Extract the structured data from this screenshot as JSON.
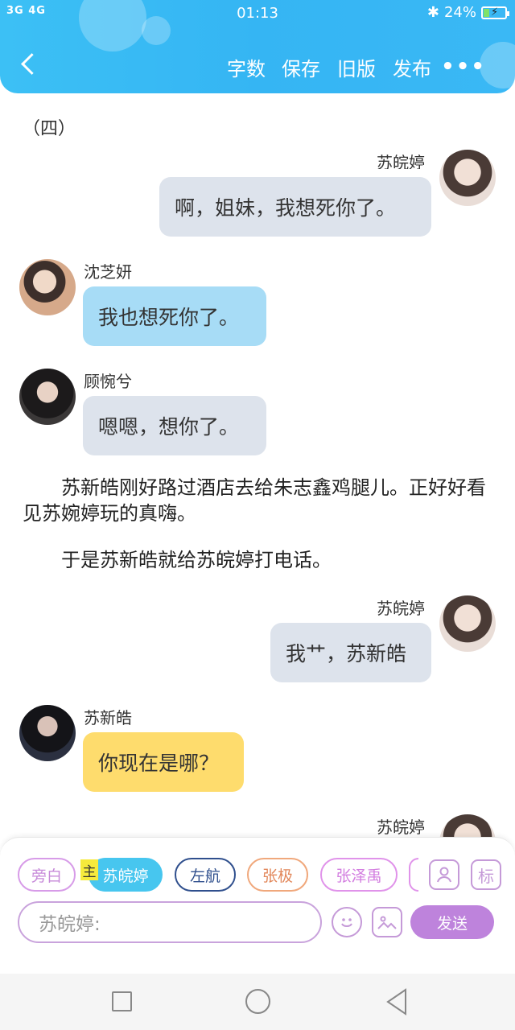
{
  "status": {
    "signal": "3G 4G",
    "time": "01:13",
    "battery": "24%",
    "battery_level": 0.24
  },
  "toolbar": {
    "items": [
      "字数",
      "保存",
      "旧版",
      "发布"
    ],
    "more": "•••"
  },
  "chapter": "（四）",
  "messages": [
    {
      "name": "苏皖婷",
      "text": "啊，姐妹，我想死你了。"
    },
    {
      "name": "沈芝妍",
      "text": "我也想死你了。"
    },
    {
      "name": "顾惋兮",
      "text": "嗯嗯，想你了。"
    },
    {
      "name": "苏皖婷",
      "text": "我艹，苏新皓"
    },
    {
      "name": "苏新皓",
      "text": "你现在是哪？"
    },
    {
      "name": "苏皖婷"
    }
  ],
  "narration": [
    "　　苏新皓刚好路过酒店去给朱志鑫鸡腿儿。正好好看见苏婉婷玩的真嗨。",
    "　　于是苏新皓就给苏皖婷打电话。"
  ],
  "chips": {
    "main_tag": "主",
    "items": [
      "旁白",
      "苏皖婷",
      "左航",
      "张极",
      "张泽禹"
    ]
  },
  "icons": {
    "role": "person-icon",
    "mark": "标",
    "emoji": "smiley-icon",
    "image": "image-icon"
  },
  "input": {
    "placeholder": "苏皖婷:"
  },
  "send_label": "发送"
}
